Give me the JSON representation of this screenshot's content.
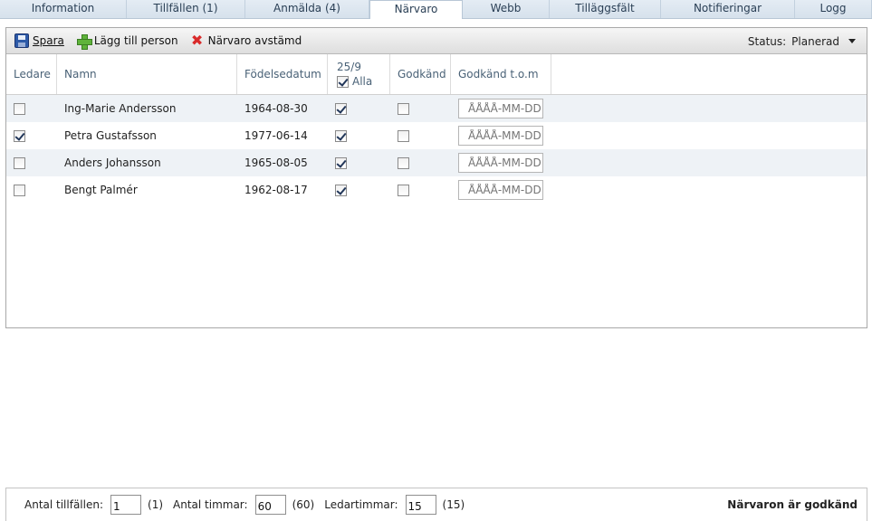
{
  "tabs": [
    {
      "label": "Information"
    },
    {
      "label": "Tillfällen (1)"
    },
    {
      "label": "Anmälda (4)"
    },
    {
      "label": "Närvaro"
    },
    {
      "label": "Webb"
    },
    {
      "label": "Tilläggsfält"
    },
    {
      "label": "Notifieringar"
    },
    {
      "label": "Logg"
    }
  ],
  "active_tab": "Närvaro",
  "toolbar": {
    "save_label": "Spara",
    "add_person_label": "Lägg till person",
    "attendance_label": "Närvaro avstämd",
    "status_label": "Status:",
    "status_value": "Planerad"
  },
  "grid": {
    "headers": {
      "leader": "Ledare",
      "name": "Namn",
      "birthdate": "Födelsedatum",
      "session_date": "25/9",
      "all": "Alla",
      "approved": "Godkänd",
      "approved_until": "Godkänd t.o.m"
    },
    "all_checked": true,
    "rows": [
      {
        "leader": false,
        "name": "Ing-Marie Andersson",
        "birthdate": "1964-08-30",
        "present": true,
        "approved": false,
        "approved_until_placeholder": "ÅÅÅÅ-MM-DD"
      },
      {
        "leader": true,
        "name": "Petra Gustafsson",
        "birthdate": "1977-06-14",
        "present": true,
        "approved": false,
        "approved_until_placeholder": "ÅÅÅÅ-MM-DD"
      },
      {
        "leader": false,
        "name": "Anders Johansson",
        "birthdate": "1965-08-05",
        "present": true,
        "approved": false,
        "approved_until_placeholder": "ÅÅÅÅ-MM-DD"
      },
      {
        "leader": false,
        "name": "Bengt Palmér",
        "birthdate": "1962-08-17",
        "present": true,
        "approved": false,
        "approved_until_placeholder": "ÅÅÅÅ-MM-DD"
      }
    ]
  },
  "footer": {
    "sessions_label": "Antal tillfällen:",
    "sessions_value": "1",
    "sessions_total": "(1)",
    "hours_label": "Antal timmar:",
    "hours_value": "60",
    "hours_total": "(60)",
    "leader_hours_label": "Ledartimmar:",
    "leader_hours_value": "15",
    "leader_hours_total": "(15)",
    "status_text": "Närvaron är godkänd"
  },
  "icons": {
    "save": "floppy-disk-icon",
    "add": "green-plus-icon",
    "attendance": "red-x-icon",
    "status_dropdown": "caret-down-icon"
  }
}
